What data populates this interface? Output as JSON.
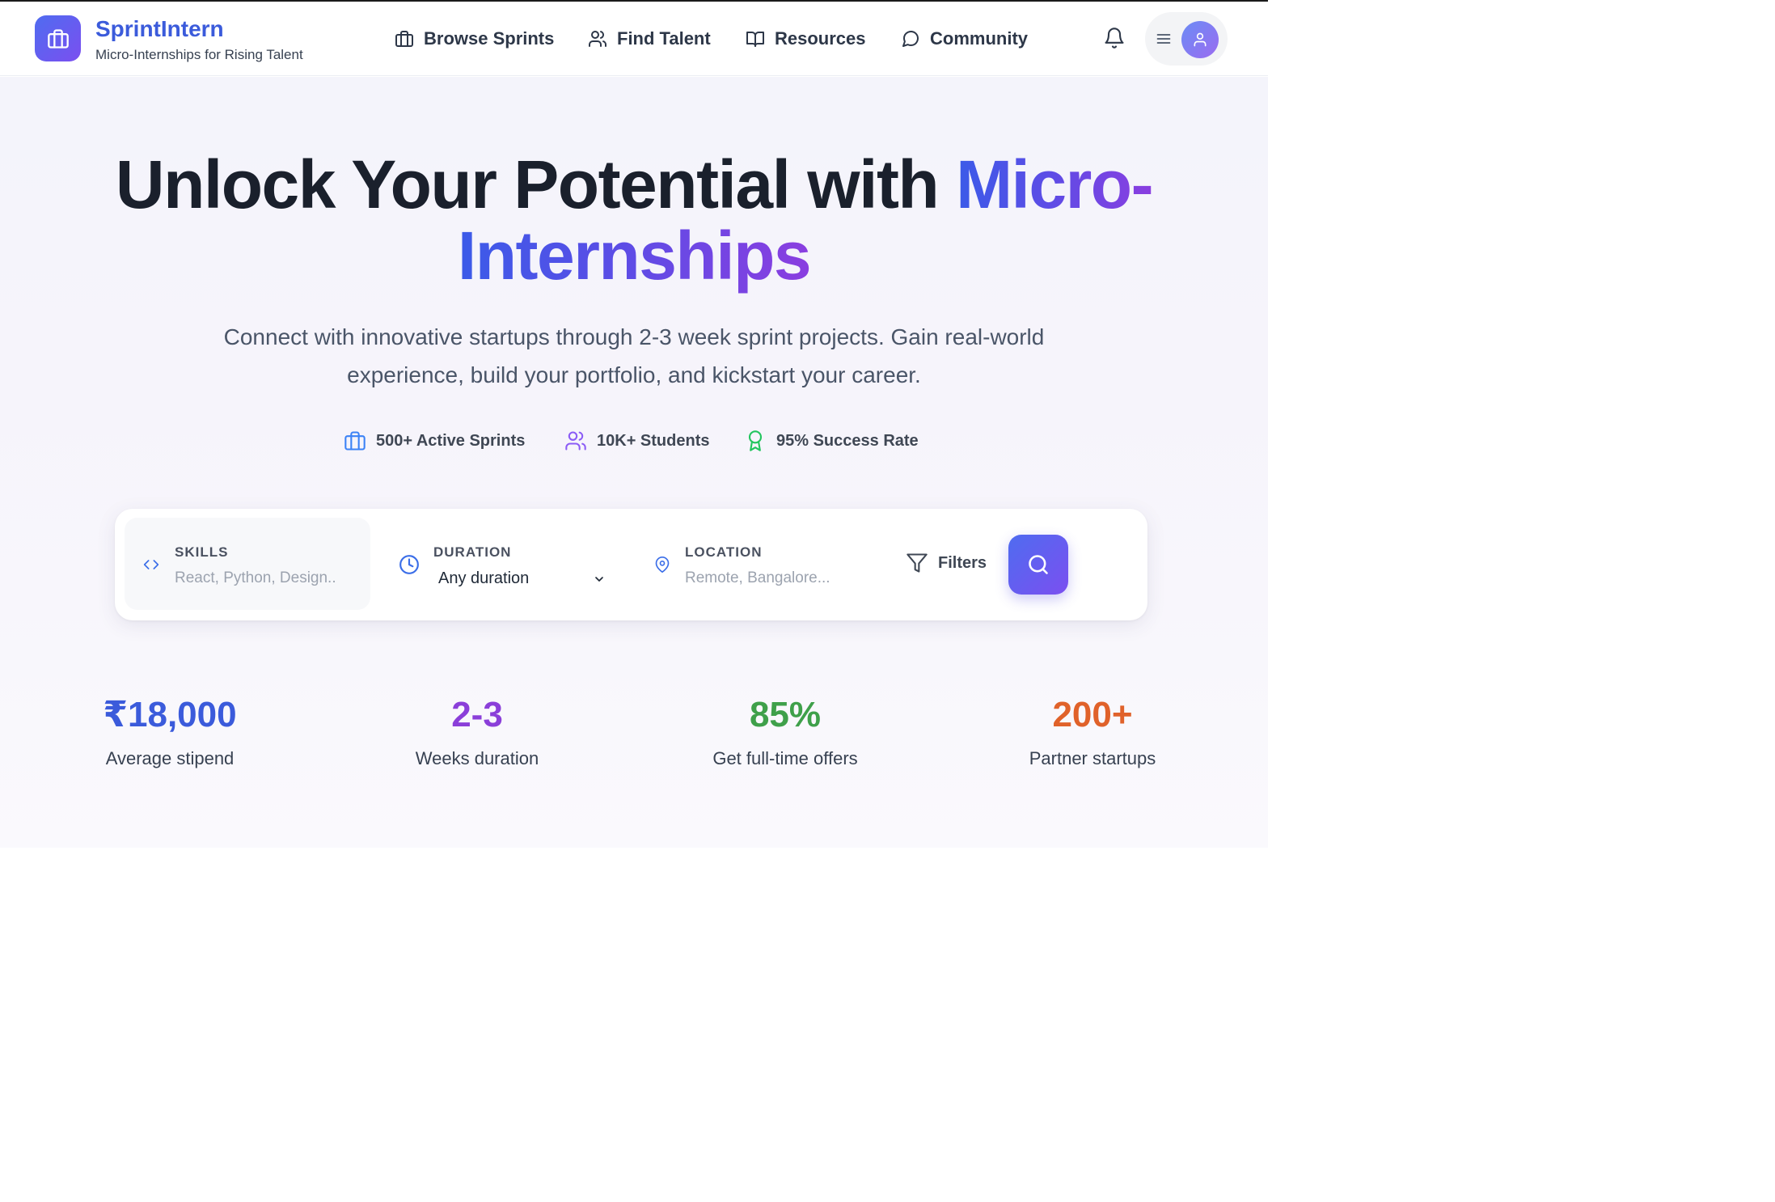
{
  "brand": {
    "name": "SprintIntern",
    "tagline": "Micro-Internships for Rising Talent"
  },
  "nav": {
    "items": [
      {
        "label": "Browse Sprints",
        "icon": "briefcase-icon"
      },
      {
        "label": "Find Talent",
        "icon": "users-icon"
      },
      {
        "label": "Resources",
        "icon": "book-icon"
      },
      {
        "label": "Community",
        "icon": "chat-icon"
      }
    ]
  },
  "hero": {
    "title_plain": "Unlock Your Potential with ",
    "title_highlight_1": "Micro-",
    "title_highlight_2": "Internships",
    "subtitle": "Connect with innovative startups through 2-3 week sprint projects. Gain real-world experience, build your portfolio, and kickstart your career."
  },
  "highlights": [
    {
      "text": "500+ Active Sprints",
      "icon": "briefcase-icon",
      "color": "#3b82f6"
    },
    {
      "text": "10K+ Students",
      "icon": "users-icon",
      "color": "#8b5cf6"
    },
    {
      "text": "95% Success Rate",
      "icon": "award-icon",
      "color": "#22c55e"
    }
  ],
  "search": {
    "skills_label": "SKILLS",
    "skills_placeholder": "React, Python, Design..",
    "duration_label": "DURATION",
    "duration_value": "Any duration",
    "location_label": "LOCATION",
    "location_placeholder": "Remote, Bangalore...",
    "filters_label": "Filters"
  },
  "metrics": [
    {
      "value": "₹18,000",
      "caption": "Average stipend",
      "color": "#3b5bdb"
    },
    {
      "value": "2-3",
      "caption": "Weeks duration",
      "color": "#8b3fd9"
    },
    {
      "value": "85%",
      "caption": "Get full-time offers",
      "color": "#3fa04a"
    },
    {
      "value": "200+",
      "caption": "Partner startups",
      "color": "#e0622a"
    }
  ],
  "colors": {
    "accent": "#3b5bdb",
    "gradient_start": "#4f6cf0",
    "gradient_end": "#7b4ff0"
  }
}
